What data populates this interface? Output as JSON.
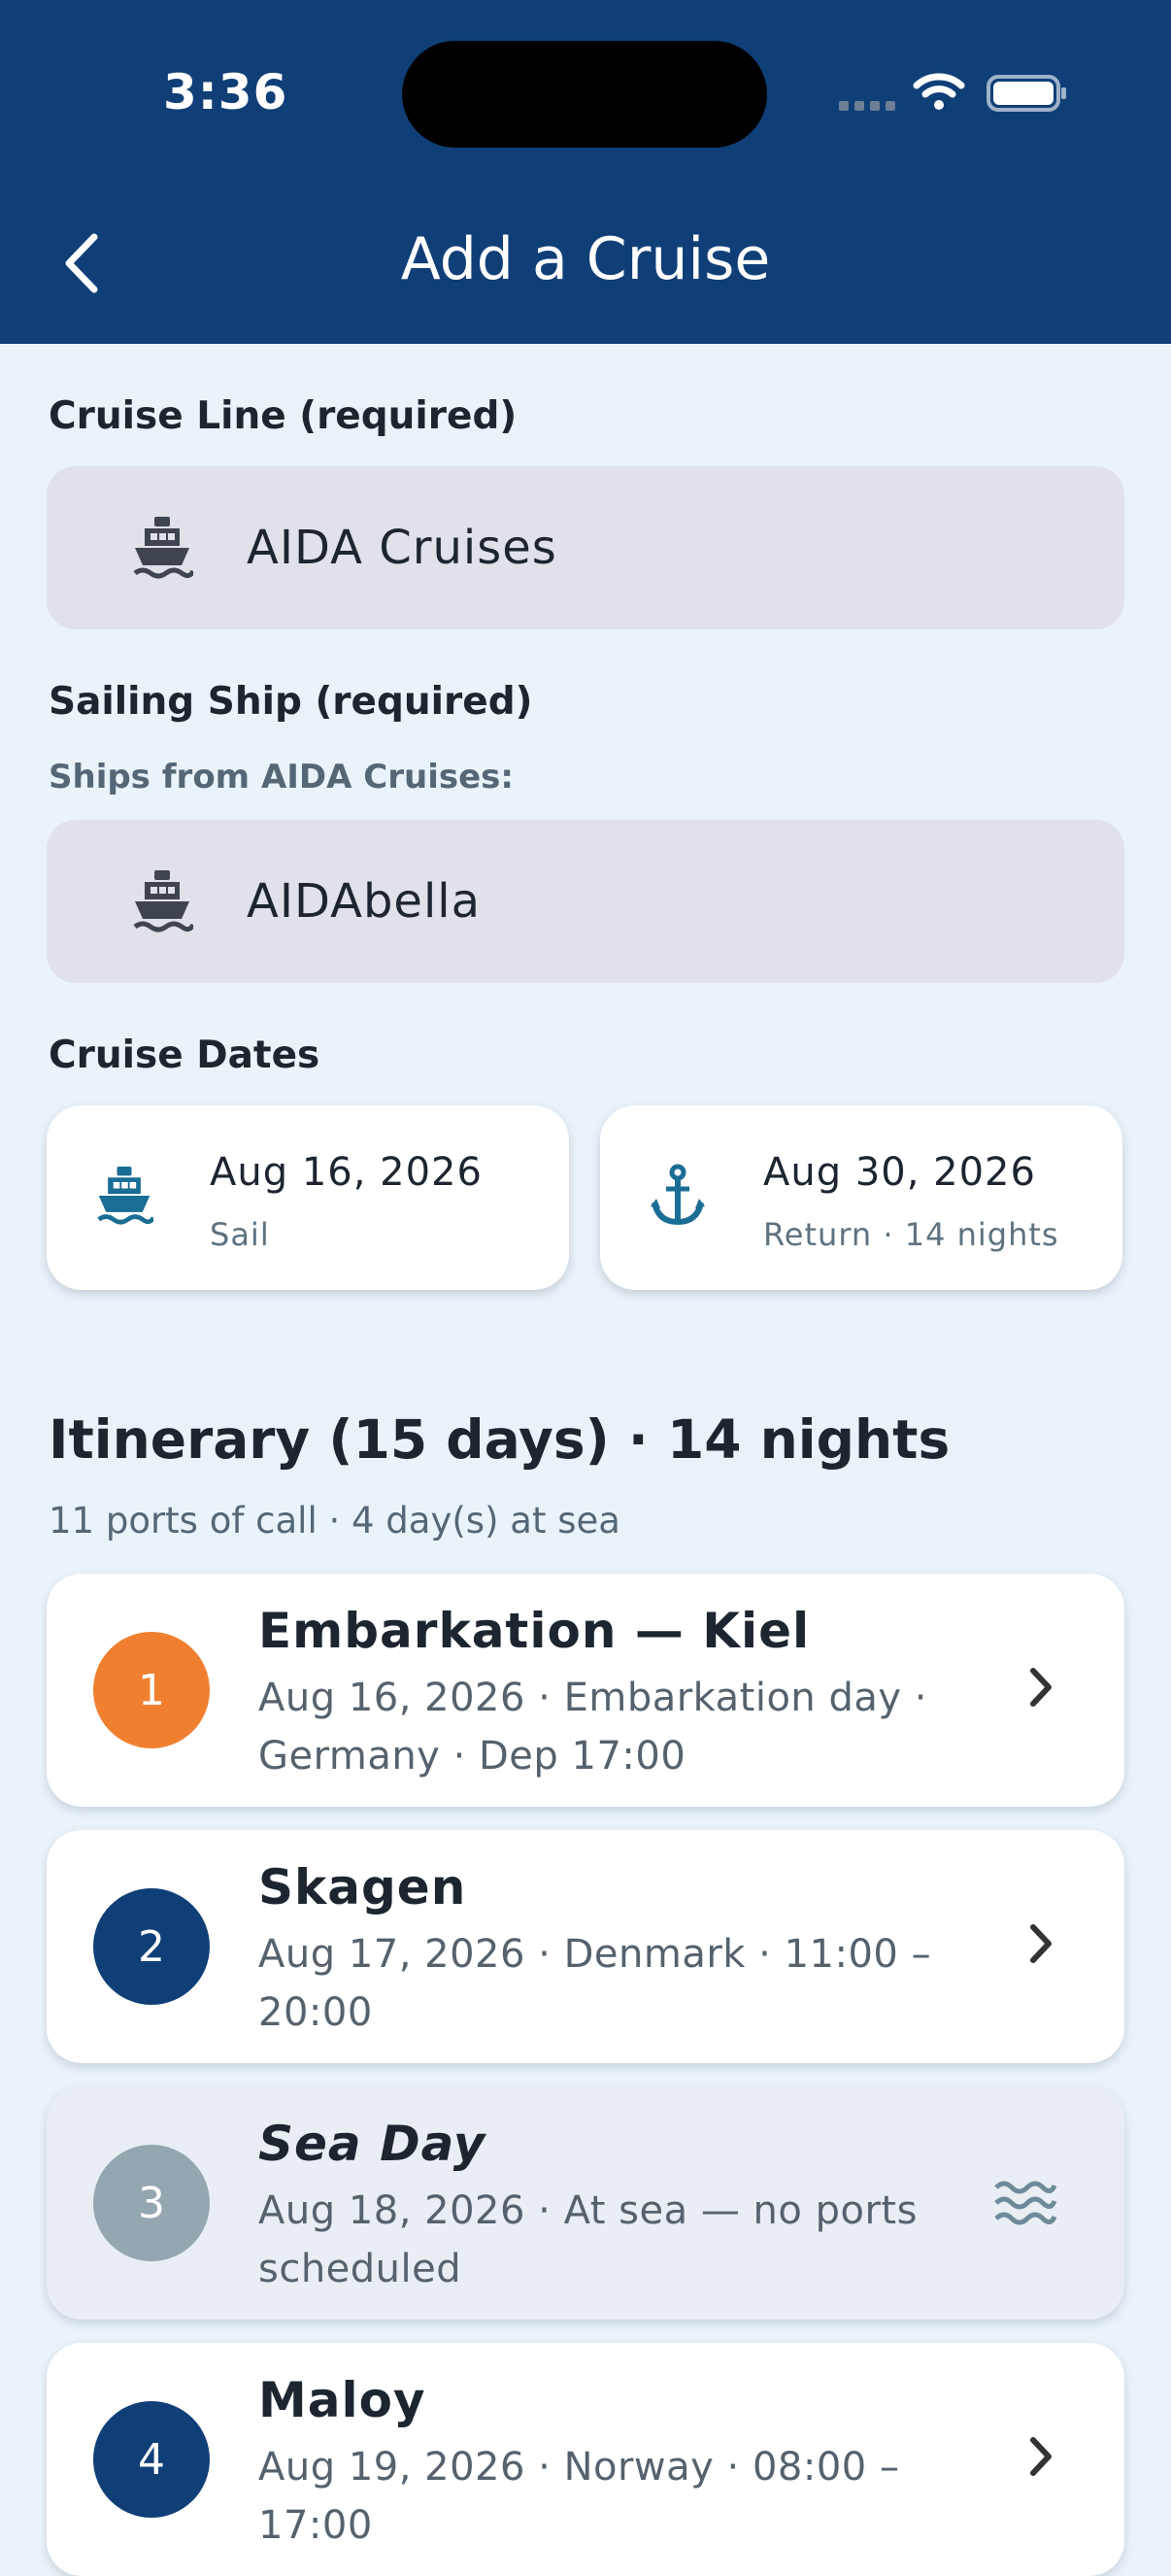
{
  "status_bar": {
    "time": "3:36"
  },
  "header": {
    "title": "Add a Cruise"
  },
  "cruise_line": {
    "label": "Cruise Line (required)",
    "value": "AIDA Cruises"
  },
  "ship": {
    "label": "Sailing Ship (required)",
    "sublabel": "Ships from AIDA Cruises:",
    "value": "AIDAbella"
  },
  "dates": {
    "label": "Cruise Dates",
    "sail": {
      "date": "Aug 16, 2026",
      "caption": "Sail"
    },
    "return": {
      "date": "Aug 30, 2026",
      "caption": "Return · 14 nights"
    }
  },
  "itinerary": {
    "title": "Itinerary (15 days) · 14 nights",
    "summary": "11 ports of call · 4 day(s) at sea",
    "stops": [
      {
        "number": "1",
        "name": "Embarkation — Kiel",
        "details": "Aug 16, 2026 · Embarkation day · Germany · Dep 17:00",
        "color": "#F08030"
      },
      {
        "number": "2",
        "name": "Skagen",
        "details": "Aug 17, 2026 · Denmark · 11:00 – 20:00",
        "color": "#103F78"
      },
      {
        "number": "3",
        "name": "Sea Day",
        "details": "Aug 18, 2026 · At sea — no ports scheduled",
        "color": "#94A6B0"
      },
      {
        "number": "4",
        "name": "Maloy",
        "details": "Aug 19, 2026 · Norway · 08:00 – 17:00",
        "color": "#103F78"
      }
    ]
  },
  "colors": {
    "header": "#103F78",
    "accent": "#1A6E95",
    "background": "#EAF3FA"
  }
}
